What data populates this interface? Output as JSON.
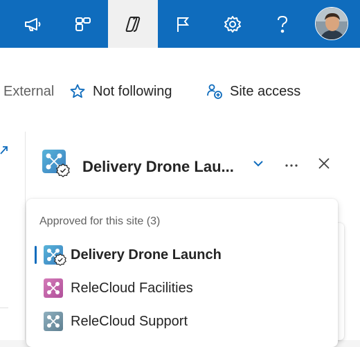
{
  "topbar": {
    "buttons": [
      {
        "icon": "megaphone-icon",
        "label": "What's new"
      },
      {
        "icon": "apps-icon",
        "label": "Apps"
      },
      {
        "icon": "copilot-icon",
        "label": "Copilot"
      },
      {
        "icon": "flag-icon",
        "label": "Flag"
      },
      {
        "icon": "gear-icon",
        "label": "Settings"
      },
      {
        "icon": "help-icon",
        "label": "Help"
      }
    ],
    "bar_color": "#0f6cbd"
  },
  "commandbar": {
    "external_label": "External",
    "follow_label": "Not following",
    "site_access_label": "Site access"
  },
  "panel": {
    "site_title": "Delivery Drone Lau...",
    "more_icon": "more-horizontal-icon",
    "close_icon": "close-icon",
    "chevron_icon": "chevron-down-icon"
  },
  "dropdown": {
    "heading": "Approved for this site (3)",
    "items": [
      {
        "label": "Delivery Drone Launch",
        "selected": true,
        "color": "#4aa3c9"
      },
      {
        "label": "ReleCloud Facilities",
        "selected": false,
        "color": "#c15fa8"
      },
      {
        "label": "ReleCloud Support",
        "selected": false,
        "color": "#6b8e9e"
      }
    ]
  },
  "colors": {
    "accent": "#0f6cbd",
    "text": "#242424",
    "muted": "#616161"
  }
}
